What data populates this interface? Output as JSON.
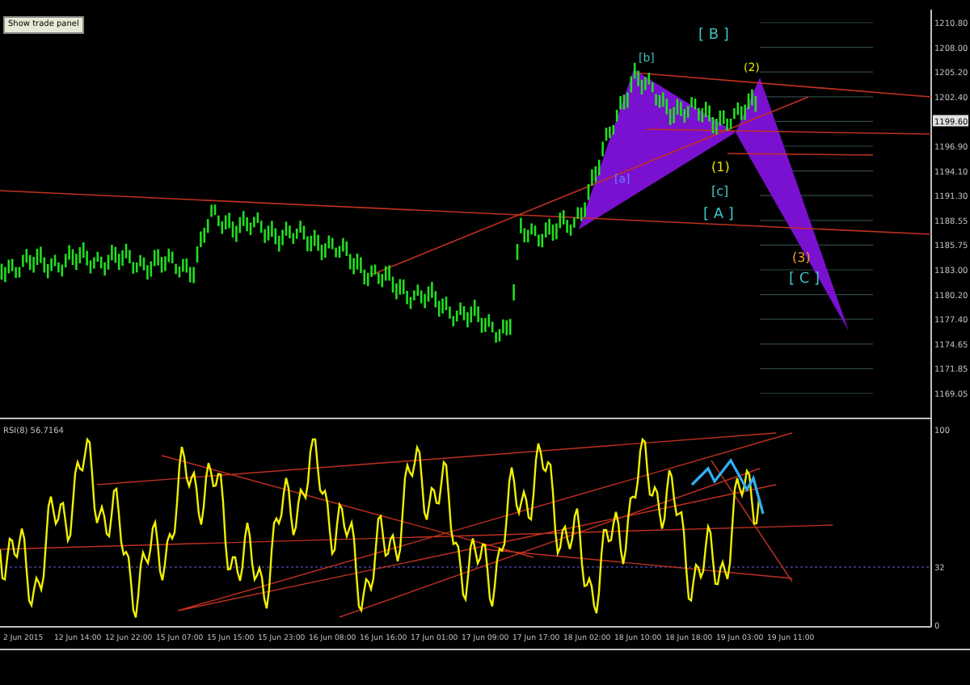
{
  "toolbar": {
    "button": "Show trade panel"
  },
  "price_axis": [
    {
      "label": "1210.80",
      "highlighted": false
    },
    {
      "label": "1208.00",
      "highlighted": false
    },
    {
      "label": "1205.20",
      "highlighted": false
    },
    {
      "label": "1202.40",
      "highlighted": false
    },
    {
      "label": "1199.60",
      "highlighted": true
    },
    {
      "label": "1196.90",
      "highlighted": false
    },
    {
      "label": "1194.10",
      "highlighted": false
    },
    {
      "label": "1191.30",
      "highlighted": false
    },
    {
      "label": "1188.55",
      "highlighted": false
    },
    {
      "label": "1185.75",
      "highlighted": false
    },
    {
      "label": "1183.00",
      "highlighted": false
    },
    {
      "label": "1180.20",
      "highlighted": false
    },
    {
      "label": "1177.40",
      "highlighted": false
    },
    {
      "label": "1174.65",
      "highlighted": false
    },
    {
      "label": "1171.85",
      "highlighted": false
    },
    {
      "label": "1169.05",
      "highlighted": false
    }
  ],
  "wave_labels": [
    {
      "text": "[ B ]",
      "color": "#40c0c0"
    },
    {
      "text": "[b]",
      "color": "#40c0c0"
    },
    {
      "text": "(2)",
      "color": "#e8e000"
    },
    {
      "text": "[a]",
      "color": "#6080ff"
    },
    {
      "text": "(1)",
      "color": "#e8e000"
    },
    {
      "text": "[c]",
      "color": "#40c0c0"
    },
    {
      "text": "[ A ]",
      "color": "#40c0c0"
    },
    {
      "text": "(3)",
      "color": "#f0a020"
    },
    {
      "text": "[ C ]",
      "color": "#40c0c0"
    }
  ],
  "rsi": {
    "label": "RSI(8) 56.7164",
    "axis": [
      "100",
      "32",
      "0"
    ]
  },
  "time_axis": [
    "2 Jun 2015",
    "12 Jun 14:00",
    "12 Jun 22:00",
    "15 Jun 07:00",
    "15 Jun 15:00",
    "15 Jun 23:00",
    "16 Jun 08:00",
    "16 Jun 16:00",
    "17 Jun 01:00",
    "17 Jun 09:00",
    "17 Jun 17:00",
    "18 Jun 02:00",
    "18 Jun 10:00",
    "18 Jun 18:00",
    "19 Jun 03:00",
    "19 Jun 11:00"
  ]
}
